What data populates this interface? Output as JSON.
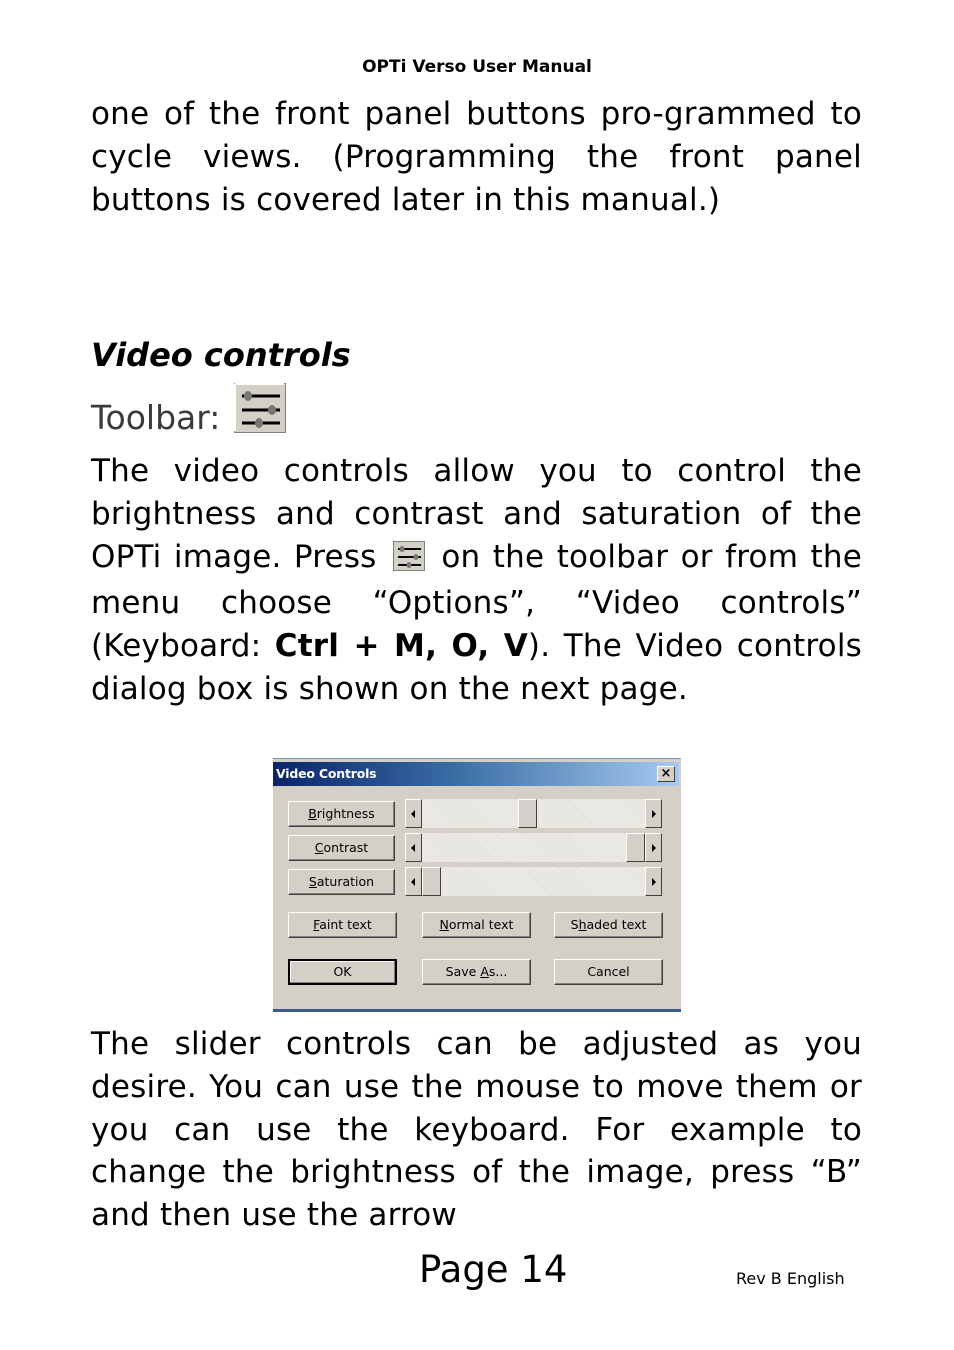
{
  "header": {
    "title": "OPTi Verso User Manual"
  },
  "intro_paragraph": "one of the front panel buttons pro-grammed to cycle views. (Programming the front panel buttons is covered later in this manual.)",
  "section": {
    "heading": "Video controls",
    "toolbar_label": "Toolbar:",
    "toolbar_icon": "video-controls-sliders-icon",
    "body": {
      "part1": "The video controls allow you to control the brightness and contrast and saturation of the OPTi image. Press",
      "part2": "on the toolbar or from the menu choose “Options”, “Video controls” (Keyboard:",
      "shortcut": "Ctrl + M, O, V",
      "part3": "). The Video controls dialog box is shown on the next page."
    }
  },
  "dialog": {
    "title": "Video Controls",
    "close_label": "×",
    "sliders": [
      {
        "label": "Brightness",
        "accel": "B",
        "rest": "rightness",
        "value_percent": 47
      },
      {
        "label": "Contrast",
        "accel": "C",
        "rest": "ontrast",
        "value_percent": 100
      },
      {
        "label": "Saturation",
        "accel": "S",
        "rest": "aturation",
        "value_percent": 0
      }
    ],
    "text_buttons": [
      {
        "pre": "",
        "accel": "F",
        "post": "aint text"
      },
      {
        "pre": "",
        "accel": "N",
        "post": "ormal text"
      },
      {
        "pre": "S",
        "accel": "h",
        "post": "aded text"
      }
    ],
    "ok_label": "OK",
    "save_as": {
      "pre": "Save ",
      "accel": "A",
      "post": "s..."
    },
    "cancel_label": "Cancel"
  },
  "closing_paragraph": "The slider controls can be adjusted as you desire. You can use the mouse to move them or you can use the keyboard. For example to change the brightness of the image, press “B” and then use the arrow",
  "footer": {
    "page": "Page 14",
    "revision": "Rev B English"
  }
}
